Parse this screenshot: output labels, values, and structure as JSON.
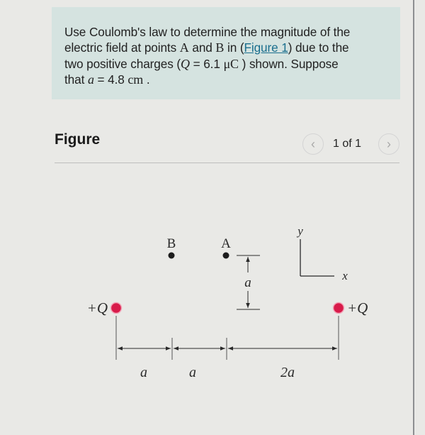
{
  "problem": {
    "line1": "Use Coulomb's law to determine the magnitude of the",
    "line2_pre": "electric field at points ",
    "point_a": "A",
    "and": " and ",
    "point_b": "B",
    "in": " in (",
    "figure_link": "Figure 1",
    "line2_post": ") due to the",
    "line3_pre": "two positive charges (",
    "q_symbol": "Q",
    "q_eq": " = 6.1 ",
    "q_unit": "μC",
    "line3_post": " ) shown. Suppose",
    "line4_pre": "that ",
    "a_symbol": "a",
    "a_eq": " = 4.8 ",
    "a_unit": "cm",
    "line4_post": " ."
  },
  "figure": {
    "title": "Figure",
    "page_indicator": "1 of 1",
    "prev_icon": "‹",
    "next_icon": "›"
  },
  "diagram": {
    "charge_color": "#d81b4a",
    "left_charge_label": "+Q",
    "right_charge_label": "+Q",
    "point_b_label": "B",
    "point_a_label": "A",
    "vertical_distance_label": "a",
    "axis_y_label": "y",
    "axis_x_label": "x",
    "segment_labels": [
      "a",
      "a",
      "2a"
    ]
  }
}
